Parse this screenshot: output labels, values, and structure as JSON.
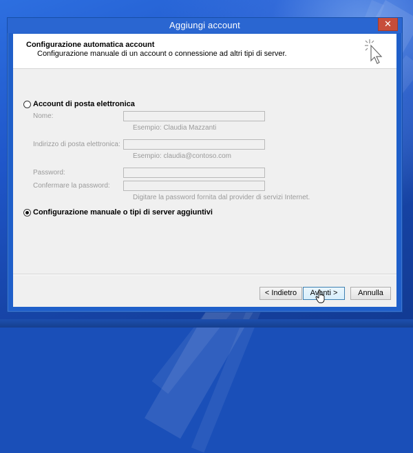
{
  "window": {
    "title": "Aggiungi account",
    "close_glyph": "✕"
  },
  "header": {
    "title": "Configurazione automatica account",
    "subtitle": "Configurazione manuale di un account o connessione ad altri tipi di server.",
    "icon": "wand-cursor-icon"
  },
  "options": {
    "email_account": {
      "label": "Account di posta elettronica",
      "selected": false
    },
    "manual": {
      "label": "Configurazione manuale o tipi di server aggiuntivi",
      "selected": true
    }
  },
  "fields": {
    "name": {
      "label": "Nome:",
      "value": "",
      "hint": "Esempio: Claudia Mazzanti"
    },
    "email": {
      "label": "Indirizzo di posta elettronica:",
      "value": "",
      "hint": "Esempio: claudia@contoso.com"
    },
    "password": {
      "label": "Password:",
      "value": ""
    },
    "confirm_password": {
      "label": "Confermare la password:",
      "value": "",
      "hint": "Digitare la password fornita dal provider di servizi Internet."
    }
  },
  "buttons": {
    "back": "< Indietro",
    "next": "Avanti >",
    "cancel": "Annulla"
  },
  "colors": {
    "accent": "#2a66d1",
    "close": "#c74d3b",
    "disabled_text": "#9a9a9a"
  }
}
